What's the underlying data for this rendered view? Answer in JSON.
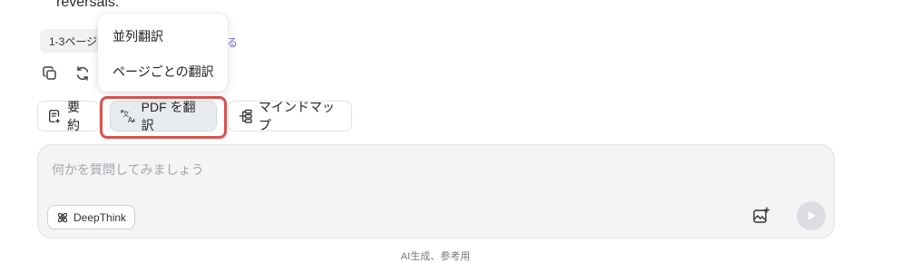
{
  "message": {
    "previous_text": "reversals.",
    "page_tag": "1-3ページ",
    "tag_link_suffix": "る"
  },
  "toolbar": {
    "summary_label": "要約",
    "translate_pdf_label": "PDF を翻訳",
    "mindmap_label": "マインドマップ"
  },
  "translate_menu": {
    "items": [
      {
        "label": "並列翻訳"
      },
      {
        "label": "ページごとの翻訳"
      }
    ]
  },
  "chat": {
    "placeholder": "何かを質問してみましょう",
    "deepthink_label": "DeepThink",
    "footer_note": "AI生成、参考用"
  },
  "colors": {
    "highlight": "#d9534f",
    "link": "#6b6bd6",
    "send_button_disabled": "#dcdde2"
  }
}
